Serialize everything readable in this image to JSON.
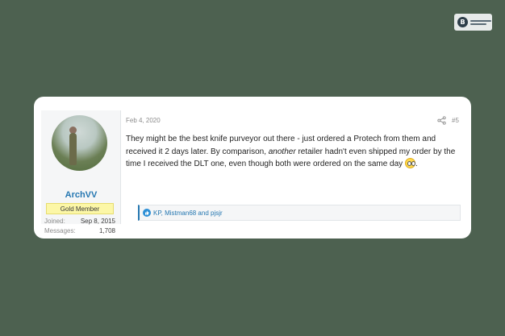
{
  "post": {
    "author": {
      "username": "ArchVV",
      "title": "Gold Member",
      "joined_label": "Joined:",
      "joined_value": "Sep 8, 2015",
      "messages_label": "Messages:",
      "messages_value": "1,708"
    },
    "date": "Feb 4, 2020",
    "number": "#5",
    "body": {
      "text_before": "They might be the best knife purveyor out there - just ordered a Protech from them and received it 2 days later. By comparison, ",
      "emphasis": "another",
      "text_after": " retailer hadn't even shipped my order by the time I received the DLT one, even though both were ordered on the same day ",
      "emoji_icon": "rolling-eyes-emoji",
      "trailing": "."
    },
    "reactions": {
      "text": "KP, Mistman68 and pjsjr",
      "icon": "like-icon"
    }
  },
  "colors": {
    "background": "#4d6150",
    "link": "#2577b1",
    "badge": "#fcf7a7"
  }
}
